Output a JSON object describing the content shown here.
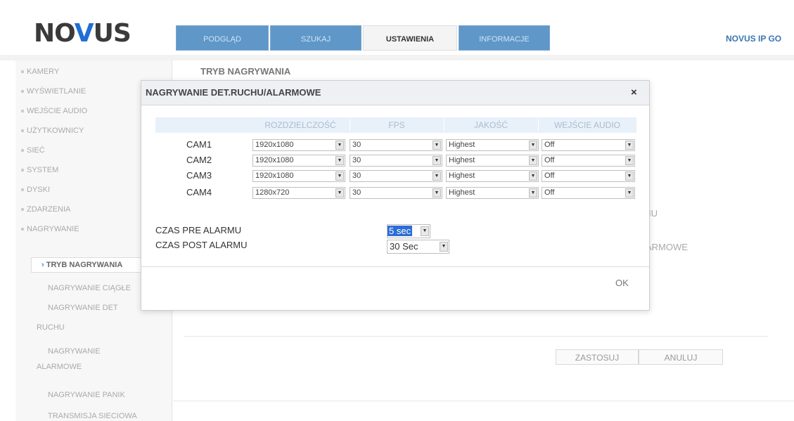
{
  "logo": {
    "part1": "NO",
    "part2": "V",
    "part3": "US"
  },
  "tabs": [
    {
      "label": "PODGLĄD"
    },
    {
      "label": "SZUKAJ"
    },
    {
      "label": "USTAWIENIA"
    },
    {
      "label": "INFORMACJE"
    }
  ],
  "brand_right": "NOVUS IP GO",
  "sidebar": {
    "items": [
      "KAMERY",
      "WYŚWIETLANIE",
      "WEJŚCIE AUDIO",
      "UŻYTKOWNICY",
      "SIEĆ",
      "SYSTEM",
      "DYSKI",
      "ZDARZENIA",
      "NAGRYWANIE"
    ],
    "active": "TRYB NAGRYWANIA",
    "sub": [
      "NAGRYWANIE CIĄGŁE",
      "NAGRYWANIE DET",
      "RUCHU",
      "NAGRYWANIE",
      "ALARMOWE",
      "NAGRYWANIE PANIK",
      "TRANSMISJA SIECIOWA"
    ]
  },
  "main": {
    "title": "TRYB NAGRYWANIA",
    "partial_1": "IU",
    "partial_2": "ARMOWE",
    "apply_button": "ZASTOSUJ",
    "cancel_button": "ANULUJ"
  },
  "dialog": {
    "title": "NAGRYWANIE DET.RUCHU/ALARMOWE",
    "close": "×",
    "headers": [
      "ROZDZIELCZOŚĆ",
      "FPS",
      "JAKOŚĆ",
      "WEJŚCIE AUDIO"
    ],
    "rows": [
      {
        "cam": "CAM1",
        "res": "1920x1080",
        "fps": "30",
        "quality": "Highest",
        "audio": "Off"
      },
      {
        "cam": "CAM2",
        "res": "1920x1080",
        "fps": "30",
        "quality": "Highest",
        "audio": "Off"
      },
      {
        "cam": "CAM3",
        "res": "1920x1080",
        "fps": "30",
        "quality": "Highest",
        "audio": "Off"
      },
      {
        "cam": "CAM4",
        "res": "1280x720",
        "fps": "30",
        "quality": "Highest",
        "audio": "Off"
      }
    ],
    "pre_alarm_label": "CZAS PRE ALARMU",
    "pre_alarm_value": "5 sec",
    "post_alarm_label": "CZAS POST ALARMU",
    "post_alarm_value": "30 Sec",
    "ok_button": "OK"
  },
  "icons": {
    "dropdown": "chevron-down-icon",
    "close": "close-icon",
    "bullet": "bullet-icon"
  },
  "colors": {
    "accent": "#2c6ed5",
    "tab_blue": "#5f97c8",
    "brand": "#3a76b4"
  }
}
